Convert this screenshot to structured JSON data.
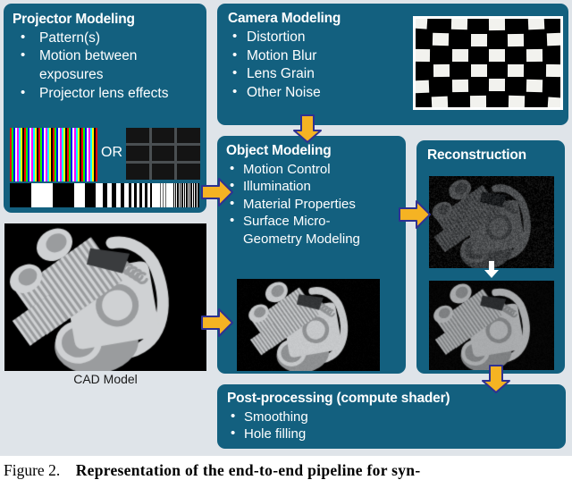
{
  "figure": {
    "background_color": "#dfe4e9",
    "box_color": "#13607f",
    "arrow_color": "#f5b323",
    "arrow_outline_color": "#2e3192"
  },
  "projector": {
    "title": "Projector Modeling",
    "bullets": [
      "Pattern(s)",
      "Motion between",
      "exposures",
      "Projector lens effects"
    ],
    "or_label": "OR",
    "pattern_color_name": "color-stripe-pattern",
    "pattern_grid_name": "grid-pattern",
    "pattern_bars_name": "binary-stripe-pattern"
  },
  "camera": {
    "title": "Camera Modeling",
    "bullets": [
      "Distortion",
      "Motion Blur",
      "Lens Grain",
      "Other Noise"
    ],
    "image_name": "distorted-checkerboard"
  },
  "object": {
    "title": "Object Modeling",
    "bullets": [
      "Motion Control",
      "Illumination",
      "Material Properties",
      "Surface Micro-",
      "Geometry Modeling"
    ],
    "image_name": "engine-render"
  },
  "reconstruction": {
    "title": "Reconstruction",
    "image_top_name": "noisy-depth-map",
    "image_bottom_name": "smoothed-depth-map"
  },
  "post": {
    "title": "Post-processing (compute shader)",
    "bullets": [
      "Smoothing",
      "Hole filling"
    ]
  },
  "cad": {
    "label": "CAD Model"
  },
  "caption": {
    "lead": "Figure 2.",
    "bold": "Representation of the end-to-end pipeline for syn-"
  }
}
